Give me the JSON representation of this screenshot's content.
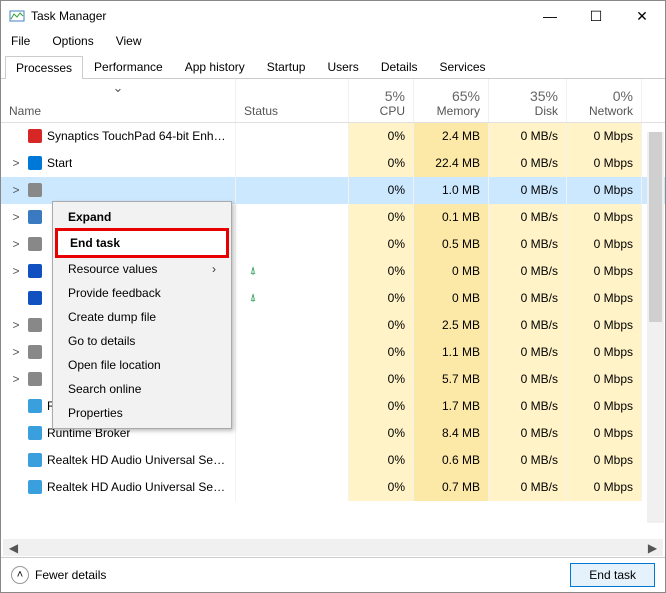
{
  "window": {
    "title": "Task Manager"
  },
  "menu": {
    "file": "File",
    "options": "Options",
    "view": "View"
  },
  "tabs": {
    "processes": "Processes",
    "performance": "Performance",
    "apphistory": "App history",
    "startup": "Startup",
    "users": "Users",
    "details": "Details",
    "services": "Services"
  },
  "headers": {
    "name": "Name",
    "status": "Status",
    "cpu": "CPU",
    "memory": "Memory",
    "disk": "Disk",
    "network": "Network",
    "cpu_pct": "5%",
    "mem_pct": "65%",
    "disk_pct": "35%",
    "net_pct": "0%"
  },
  "rows": [
    {
      "exp": "",
      "name": "Synaptics TouchPad 64-bit Enha...",
      "cpu": "0%",
      "mem": "2.4 MB",
      "disk": "0 MB/s",
      "net": "0 Mbps",
      "leaf": "",
      "icon": "#d72626"
    },
    {
      "exp": ">",
      "name": "Start",
      "cpu": "0%",
      "mem": "22.4 MB",
      "disk": "0 MB/s",
      "net": "0 Mbps",
      "leaf": "",
      "icon": "#0078d7"
    },
    {
      "exp": ">",
      "name": "",
      "cpu": "0%",
      "mem": "1.0 MB",
      "disk": "0 MB/s",
      "net": "0 Mbps",
      "leaf": "",
      "icon": "#888",
      "sel": true
    },
    {
      "exp": ">",
      "name": "",
      "cpu": "0%",
      "mem": "0.1 MB",
      "disk": "0 MB/s",
      "net": "0 Mbps",
      "leaf": "",
      "icon": "#3a7ac0"
    },
    {
      "exp": ">",
      "name": "",
      "cpu": "0%",
      "mem": "0.5 MB",
      "disk": "0 MB/s",
      "net": "0 Mbps",
      "leaf": "",
      "icon": "#888"
    },
    {
      "exp": ">",
      "name": "",
      "cpu": "0%",
      "mem": "0 MB",
      "disk": "0 MB/s",
      "net": "0 Mbps",
      "leaf": "⍋",
      "icon": "#1050c0"
    },
    {
      "exp": "",
      "name": "",
      "cpu": "0%",
      "mem": "0 MB",
      "disk": "0 MB/s",
      "net": "0 Mbps",
      "leaf": "⍋",
      "icon": "#1050c0"
    },
    {
      "exp": ">",
      "name": "",
      "cpu": "0%",
      "mem": "2.5 MB",
      "disk": "0 MB/s",
      "net": "0 Mbps",
      "leaf": "",
      "icon": "#888"
    },
    {
      "exp": ">",
      "name": "",
      "cpu": "0%",
      "mem": "1.1 MB",
      "disk": "0 MB/s",
      "net": "0 Mbps",
      "leaf": "",
      "icon": "#888"
    },
    {
      "exp": ">",
      "name": "",
      "cpu": "0%",
      "mem": "5.7 MB",
      "disk": "0 MB/s",
      "net": "0 Mbps",
      "leaf": "",
      "icon": "#888"
    },
    {
      "exp": "",
      "name": "Runtime Broker",
      "cpu": "0%",
      "mem": "1.7 MB",
      "disk": "0 MB/s",
      "net": "0 Mbps",
      "leaf": "",
      "icon": "#3aa0dd"
    },
    {
      "exp": "",
      "name": "Runtime Broker",
      "cpu": "0%",
      "mem": "8.4 MB",
      "disk": "0 MB/s",
      "net": "0 Mbps",
      "leaf": "",
      "icon": "#3aa0dd"
    },
    {
      "exp": "",
      "name": "Realtek HD Audio Universal Serv...",
      "cpu": "0%",
      "mem": "0.6 MB",
      "disk": "0 MB/s",
      "net": "0 Mbps",
      "leaf": "",
      "icon": "#3aa0dd"
    },
    {
      "exp": "",
      "name": "Realtek HD Audio Universal Serv...",
      "cpu": "0%",
      "mem": "0.7 MB",
      "disk": "0 MB/s",
      "net": "0 Mbps",
      "leaf": "",
      "icon": "#3aa0dd"
    }
  ],
  "context": {
    "expand": "Expand",
    "endtask": "End task",
    "resource": "Resource values",
    "feedback": "Provide feedback",
    "dump": "Create dump file",
    "details": "Go to details",
    "location": "Open file location",
    "search": "Search online",
    "props": "Properties"
  },
  "footer": {
    "fewer": "Fewer details",
    "endtask": "End task"
  }
}
